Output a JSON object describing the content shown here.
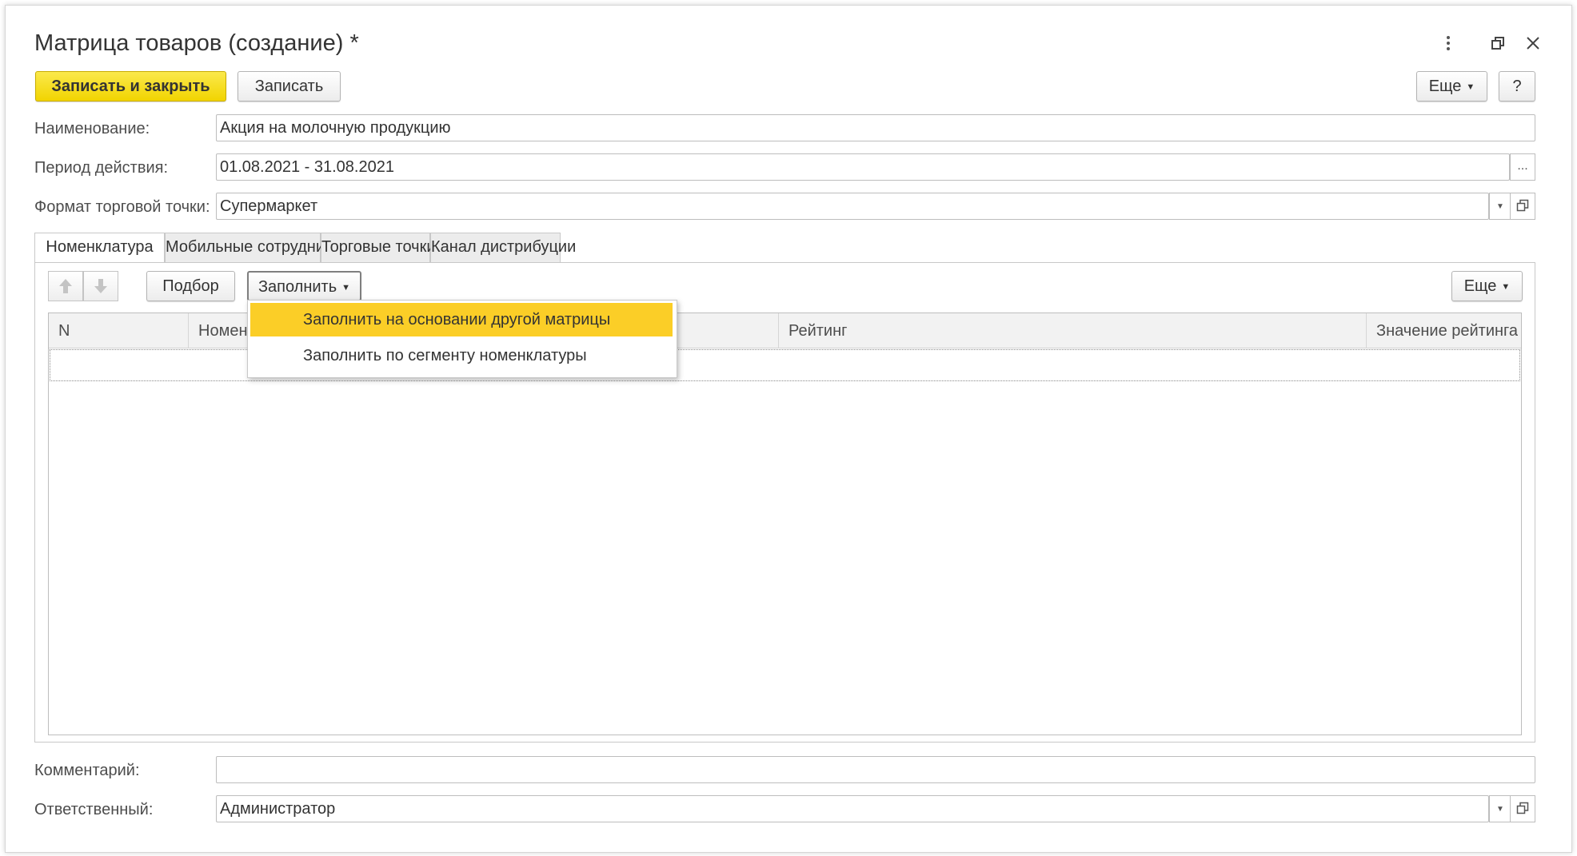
{
  "window": {
    "title": "Матрица товаров (создание) *"
  },
  "toolbar": {
    "save_close_label": "Записать и закрыть",
    "save_label": "Записать",
    "more_label": "Еще",
    "help_label": "?"
  },
  "form": {
    "name_label": "Наименование:",
    "name_value": "Акция на молочную продукцию",
    "period_label": "Период действия:",
    "period_value": "01.08.2021 - 31.08.2021",
    "period_button": "...",
    "format_label": "Формат торговой точки:",
    "format_value": "Супермаркет",
    "comment_label": "Комментарий:",
    "comment_value": "",
    "responsible_label": "Ответственный:",
    "responsible_value": "Администратор"
  },
  "tabs": [
    {
      "label": "Номенклатура",
      "active": true
    },
    {
      "label": "Мобильные сотрудники",
      "active": false
    },
    {
      "label": "Торговые точки",
      "active": false
    },
    {
      "label": "Канал дистрибуции",
      "active": false
    }
  ],
  "table_toolbar": {
    "select_label": "Подбор",
    "fill_label": "Заполнить",
    "more_label": "Еще"
  },
  "table": {
    "columns": [
      "N",
      "Номенклатура",
      "Рейтинг",
      "Значение рейтинга"
    ],
    "visible_columns": [
      "N",
      "Номен",
      "Рейтинг",
      "Значение рейтинга"
    ]
  },
  "fill_menu": {
    "items": [
      {
        "label": "Заполнить на основании другой матрицы",
        "highlighted": true
      },
      {
        "label": "Заполнить по сегменту номенклатуры",
        "highlighted": false
      }
    ]
  },
  "colors": {
    "primary_button": "#f1d400",
    "menu_highlight": "#fbce27",
    "border": "#bdbdbd",
    "tab_inactive": "#ececec"
  }
}
